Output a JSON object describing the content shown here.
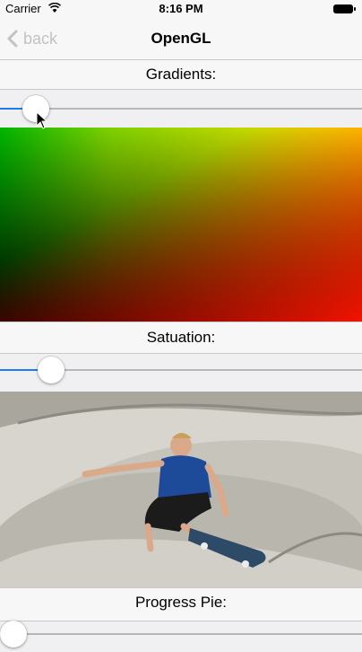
{
  "status_bar": {
    "carrier": "Carrier",
    "time": "8:16 PM"
  },
  "nav": {
    "back_label": "back",
    "title": "OpenGL"
  },
  "sections": {
    "gradients": {
      "label": "Gradients:",
      "slider_value": 0.1
    },
    "saturation": {
      "label": "Satuation:",
      "slider_value": 0.14
    },
    "progress_pie": {
      "label": "Progress Pie:",
      "slider_value": 0.03
    }
  },
  "colors": {
    "accent": "#1e7cf0",
    "nav_background": "#f7f7f7",
    "back_tint": "#c2c2c2"
  },
  "icons": [
    "wifi-icon",
    "battery-icon",
    "chevron-left-icon",
    "cursor-icon"
  ]
}
